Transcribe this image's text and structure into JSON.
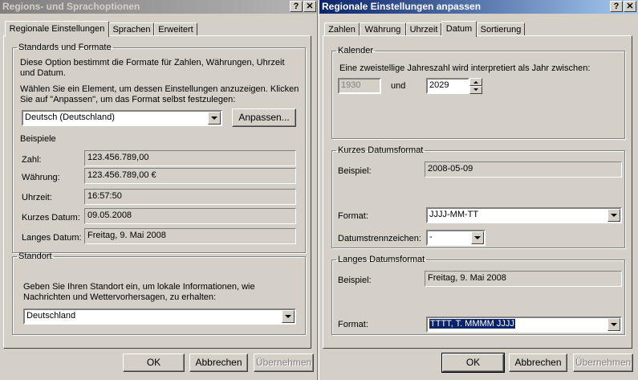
{
  "left_window": {
    "title": "Regions- und Sprachoptionen",
    "help_btn": "?",
    "close_btn": "✕",
    "tabs": [
      {
        "label": "Regionale Einstellungen"
      },
      {
        "label": "Sprachen"
      },
      {
        "label": "Erweitert"
      }
    ],
    "standards": {
      "legend": "Standards und Formate",
      "description": "Diese Option bestimmt die Formate für Zahlen, Währungen, Uhrzeit und Datum.",
      "instruction": "Wählen Sie ein Element, um dessen Einstellungen anzuzeigen. Klicken Sie auf \"Anpassen\", um das Format selbst festzulegen:",
      "selected_locale": "Deutsch (Deutschland)",
      "customize_button": "Anpassen...",
      "examples_heading": "Beispiele",
      "examples": [
        {
          "label": "Zahl:",
          "value": "123.456.789,00"
        },
        {
          "label": "Währung:",
          "value": "123.456.789,00 €"
        },
        {
          "label": "Uhrzeit:",
          "value": "16:57:50"
        },
        {
          "label": "Kurzes Datum:",
          "value": "09.05.2008"
        },
        {
          "label": "Langes Datum:",
          "value": "Freitag, 9. Mai 2008"
        }
      ]
    },
    "location": {
      "legend": "Standort",
      "description": "Geben Sie Ihren Standort ein, um lokale Informationen, wie Nachrichten und Wettervorhersagen, zu erhalten:",
      "selected": "Deutschland"
    },
    "buttons": {
      "ok": "OK",
      "cancel": "Abbrechen",
      "apply": "Übernehmen"
    }
  },
  "right_window": {
    "title": "Regionale Einstellungen anpassen",
    "help_btn": "?",
    "close_btn": "✕",
    "tabs": [
      {
        "label": "Zahlen"
      },
      {
        "label": "Währung"
      },
      {
        "label": "Uhrzeit"
      },
      {
        "label": "Datum"
      },
      {
        "label": "Sortierung"
      }
    ],
    "calendar": {
      "legend": "Kalender",
      "description": "Eine zweistellige Jahreszahl wird interpretiert als Jahr zwischen:",
      "from_year": "1930",
      "and_label": "und",
      "to_year": "2029"
    },
    "short_date": {
      "legend": "Kurzes Datumsformat",
      "example_label": "Beispiel:",
      "example_value": "2008-05-09",
      "format_label": "Format:",
      "format_value": "JJJJ-MM-TT",
      "separator_label": "Datumstrennzeichen:",
      "separator_value": "-"
    },
    "long_date": {
      "legend": "Langes Datumsformat",
      "example_label": "Beispiel:",
      "example_value": "Freitag, 9. Mai 2008",
      "format_label": "Format:",
      "format_value": "TTTT, T. MMMM JJJJ"
    },
    "buttons": {
      "ok": "OK",
      "cancel": "Abbrechen",
      "apply": "Übernehmen"
    }
  }
}
